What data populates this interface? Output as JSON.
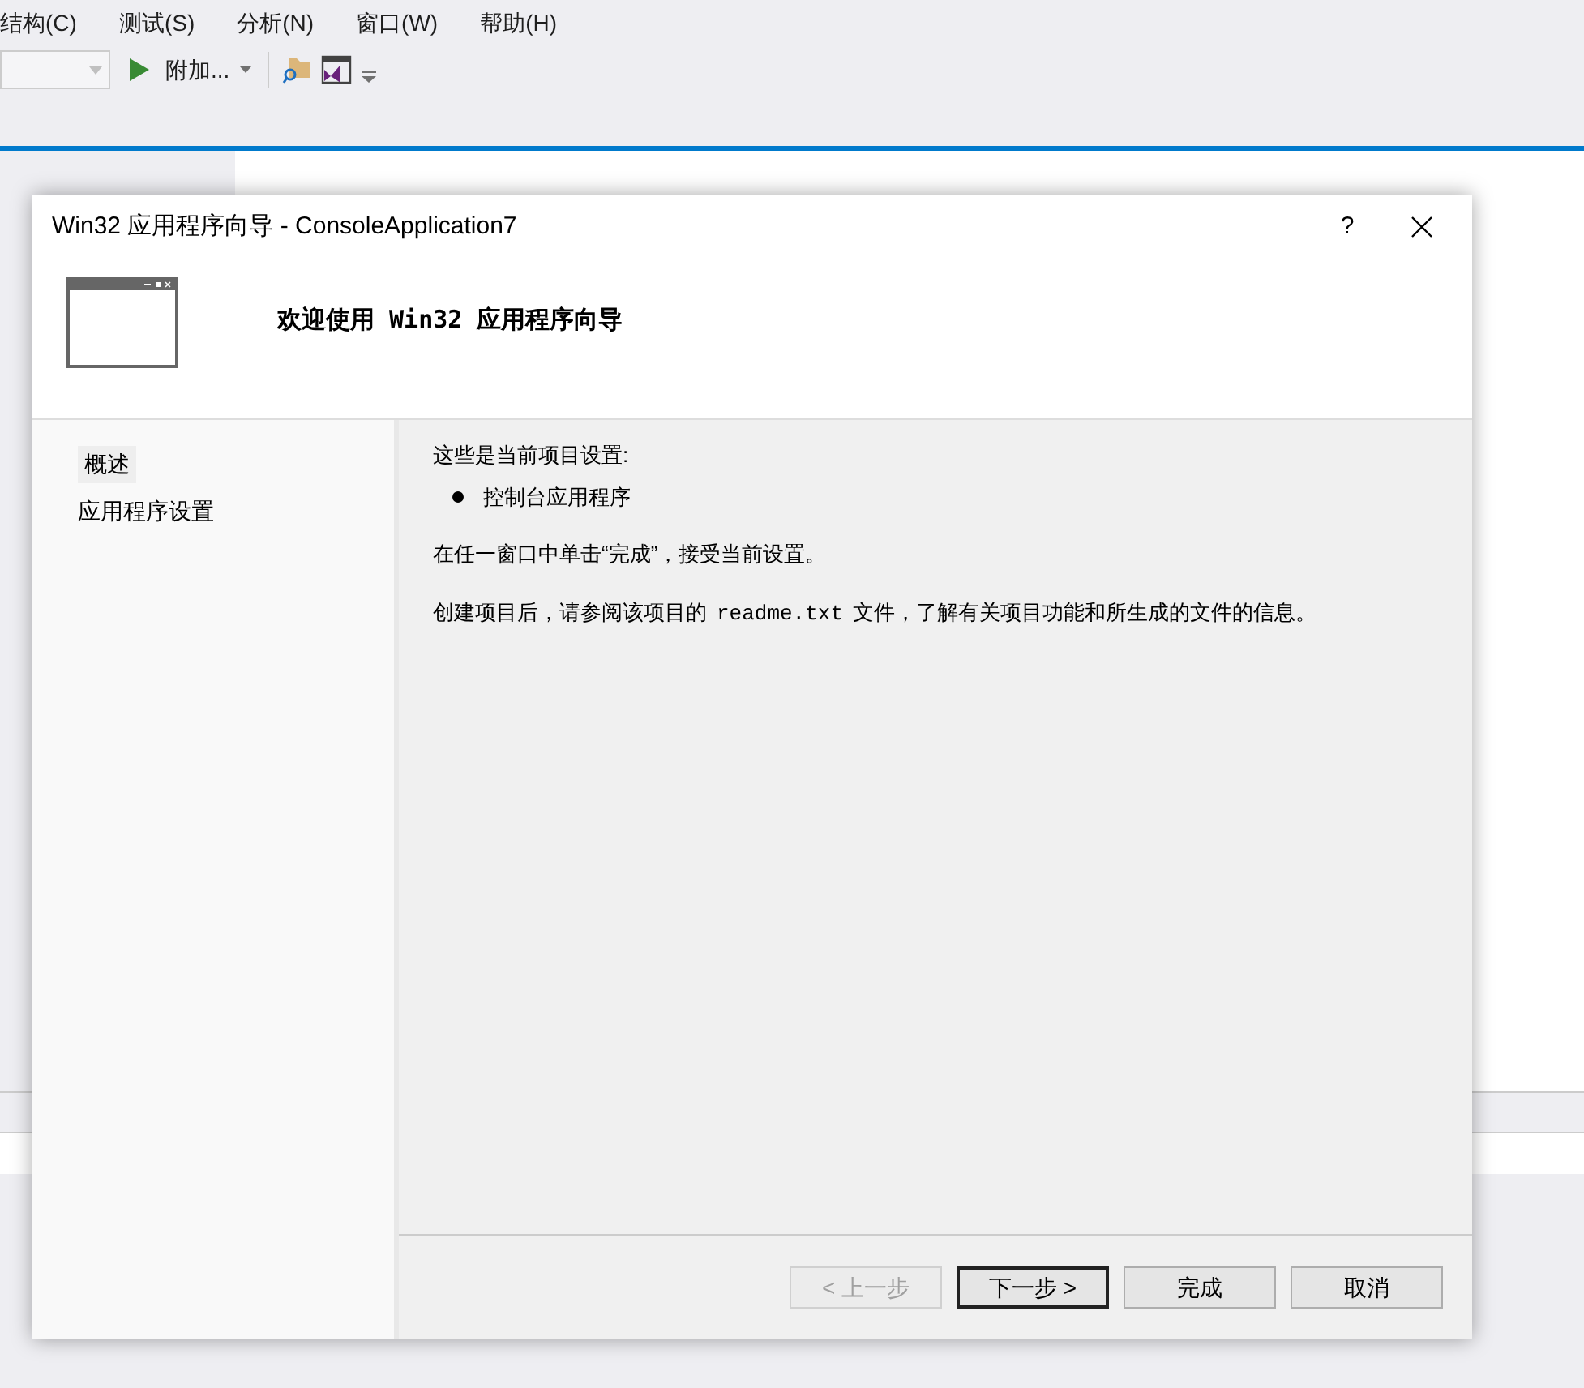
{
  "menu_bar": {
    "items": [
      "结构(C)",
      "测试(S)",
      "分析(N)",
      "窗口(W)",
      "帮助(H)"
    ]
  },
  "toolbar": {
    "run_label": "附加..."
  },
  "dialog": {
    "title": "Win32 应用程序向导 - ConsoleApplication7",
    "help": "?",
    "header_title": "欢迎使用 Win32 应用程序向导",
    "nav": [
      {
        "label": "概述",
        "selected": true
      },
      {
        "label": "应用程序设置",
        "selected": false
      }
    ],
    "content": {
      "heading": "这些是当前项目设置:",
      "bullets": [
        "控制台应用程序"
      ],
      "paragraphs": [
        [
          {
            "kind": "text",
            "text": "在任一窗口中单击“完成”，接受当前设置。"
          }
        ],
        [
          {
            "kind": "text",
            "text": "创建项目后，请参阅该项目的"
          },
          {
            "kind": "code",
            "text": "readme.txt"
          },
          {
            "kind": "text",
            "text": "文件，了解有关项目功能和所生成的文件的信息。"
          }
        ]
      ]
    },
    "buttons": [
      {
        "label": "< 上一步",
        "disabled": true,
        "default": false
      },
      {
        "label": "下一步 >",
        "disabled": false,
        "default": true
      },
      {
        "label": "完成",
        "disabled": false,
        "default": false
      },
      {
        "label": "取消",
        "disabled": false,
        "default": false
      }
    ]
  }
}
